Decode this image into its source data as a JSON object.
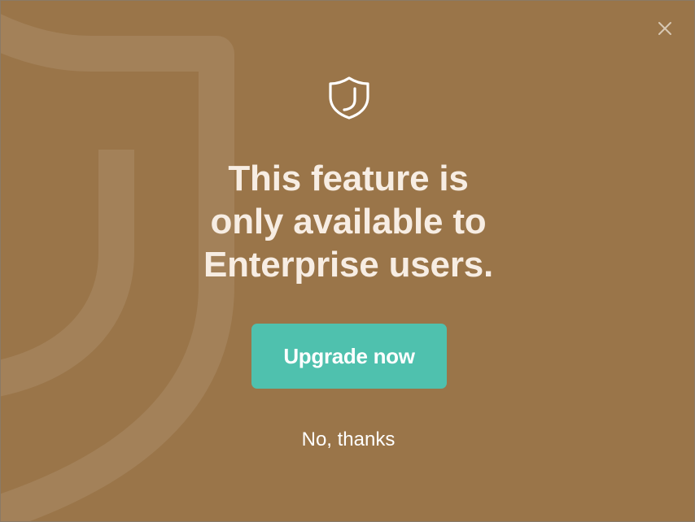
{
  "modal": {
    "headline_lines": [
      "This feature is",
      "only available to",
      "Enterprise users."
    ],
    "upgrade_label": "Upgrade now",
    "dismiss_label": "No, thanks",
    "close_icon": "close-icon",
    "header_icon": "shield-icon",
    "background_color": "#9a7549",
    "accent_color": "#4fc1ae",
    "text_color": "#f7ede3"
  }
}
